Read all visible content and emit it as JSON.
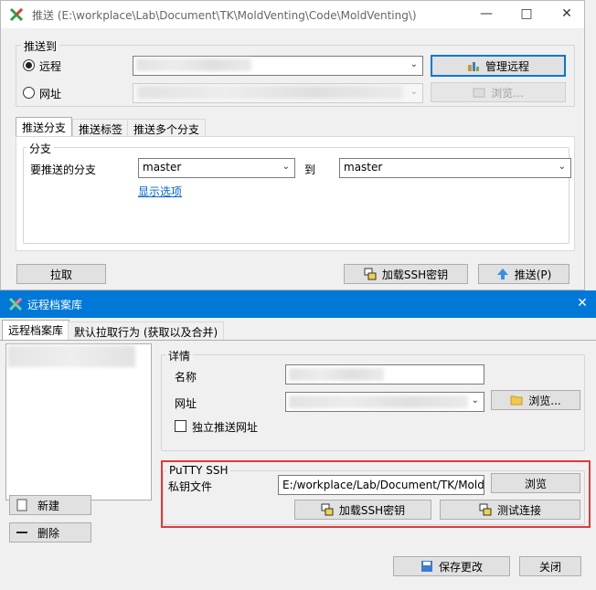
{
  "push_window": {
    "title": "推送 (E:\\workplace\\Lab\\Document\\TK\\MoldVenting\\Code\\MoldVenting\\)",
    "push_to_label": "推送到",
    "remote_label": "远程",
    "url_label": "网址",
    "manage_remotes_label": "管理远程",
    "browse_label": "浏览...",
    "tabs": [
      "推送分支",
      "推送标签",
      "推送多个分支"
    ],
    "branch_group_label": "分支",
    "branch_to_push_label": "要推送的分支",
    "local_branch": "master",
    "to_label": "到",
    "remote_branch": "master",
    "show_options_link": "显示选项",
    "pull_label": "拉取",
    "load_ssh_key_label": "加载SSH密钥",
    "push_label": "推送(P)"
  },
  "remotes_window": {
    "title": "远程档案库",
    "tabs": [
      "远程档案库",
      "默认拉取行为 (获取以及合并)"
    ],
    "new_label": "新建",
    "delete_label": "删除",
    "details_label": "详情",
    "name_label": "名称",
    "url_label": "网址",
    "browse_label": "浏览...",
    "independent_push_url_label": "独立推送网址",
    "putty_group_label": "PuTTY SSH",
    "private_key_label": "私钥文件",
    "private_key_value": "E:/workplace/Lab/Document/TK/Mold",
    "browse_key_label": "浏览",
    "load_ssh_key_label": "加载SSH密钥",
    "test_connection_label": "测试连接",
    "save_label": "保存更改",
    "close_label": "关闭"
  },
  "colors": {
    "accent": "#0078d7",
    "highlight_border": "#e03a3a"
  }
}
